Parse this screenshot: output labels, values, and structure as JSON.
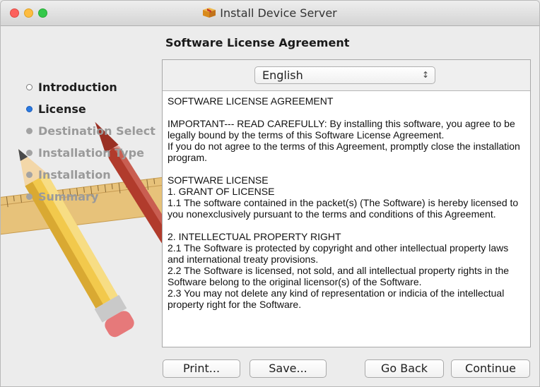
{
  "window": {
    "title": "Install Device Server"
  },
  "page": {
    "section_title": "Software License Agreement"
  },
  "steps": [
    {
      "label": "Introduction",
      "state": "done"
    },
    {
      "label": "License",
      "state": "current"
    },
    {
      "label": "Destination Select",
      "state": "pending"
    },
    {
      "label": "Installation Type",
      "state": "pending"
    },
    {
      "label": "Installation",
      "state": "pending"
    },
    {
      "label": "Summary",
      "state": "pending"
    }
  ],
  "language": {
    "selected": "English"
  },
  "license": {
    "paragraphs": [
      "SOFTWARE LICENSE AGREEMENT",
      "IMPORTANT--- READ CAREFULLY: By installing this software, you agree to be legally bound by the terms of this Software License Agreement.\nIf you do not agree to the terms of this Agreement, promptly close the installation program.",
      "SOFTWARE LICENSE\n1. GRANT OF LICENSE\n1.1 The software contained in the packet(s) (The Software) is hereby licensed to you nonexclusively pursuant to the terms and conditions of this Agreement.",
      "2. INTELLECTUAL PROPERTY RIGHT\n2.1 The Software is protected by copyright and other intellectual property laws and international treaty provisions.\n2.2 The Software is licensed, not sold, and all intellectual property rights in the Software belong to the original licensor(s) of the Software.\n2.3 You may not delete any kind of representation or indicia of the intellectual property right for the Software."
    ]
  },
  "buttons": {
    "print": "Print...",
    "save": "Save...",
    "go_back": "Go Back",
    "continue": "Continue"
  },
  "colors": {
    "close": "#fc615d",
    "minimize": "#fdbc40",
    "maximize": "#34c84a",
    "current_step": "#2a7ae2"
  }
}
